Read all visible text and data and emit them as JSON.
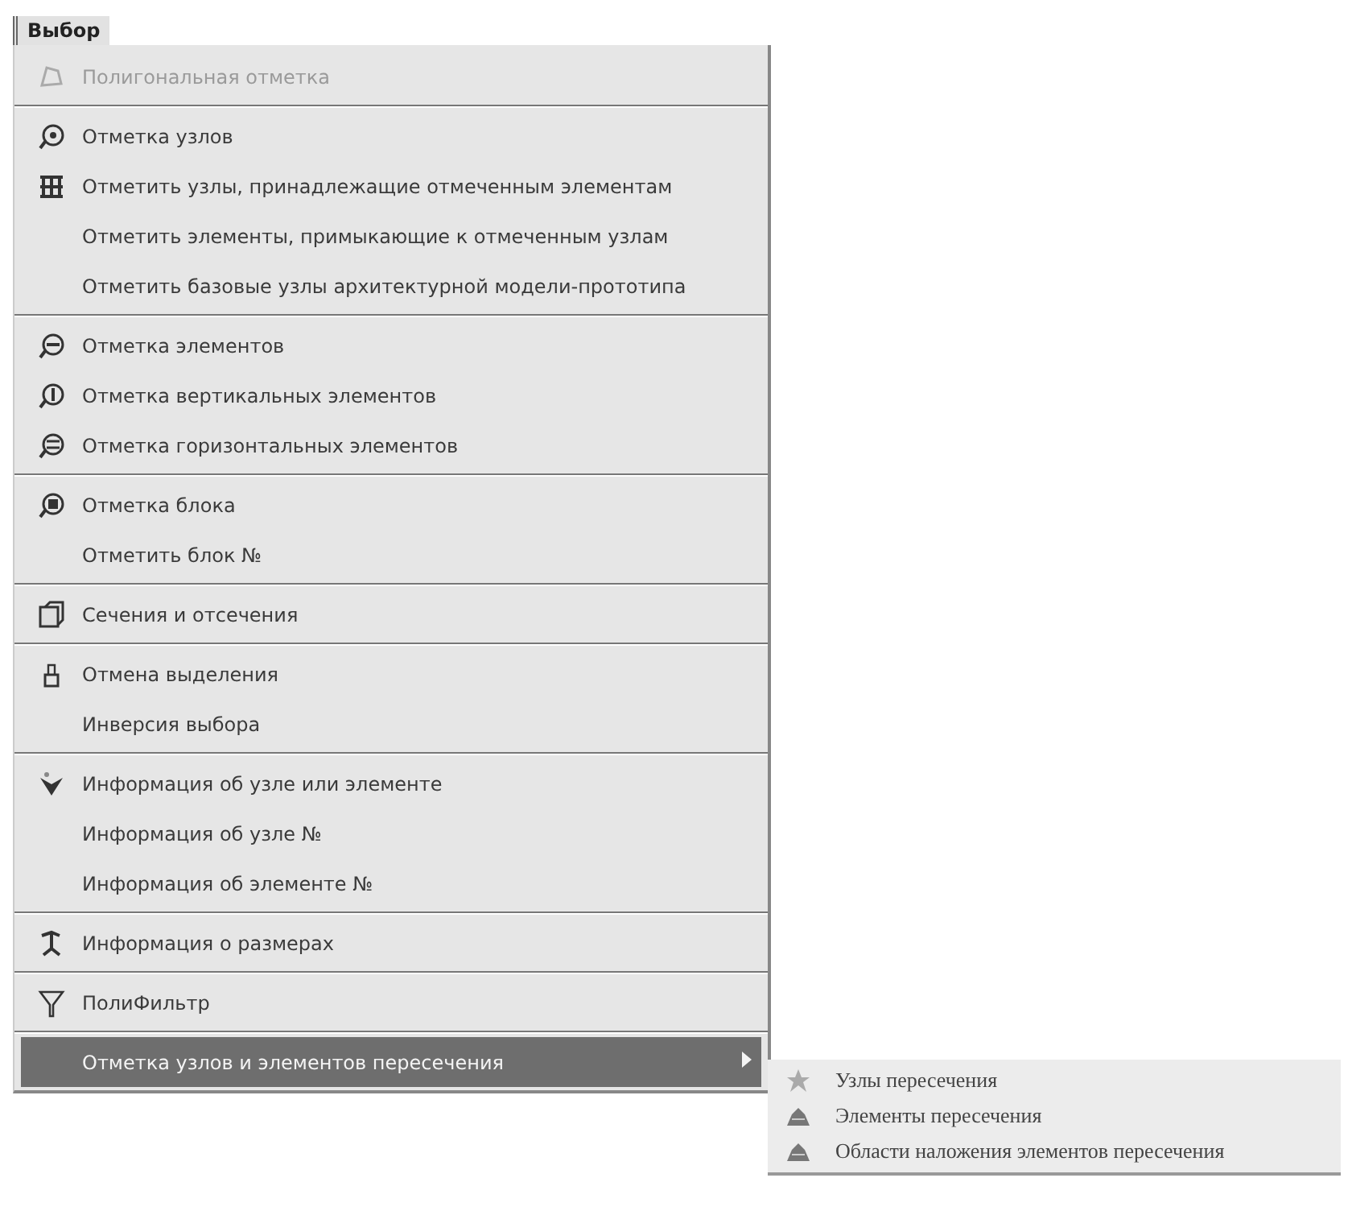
{
  "menu_title": "Выбор",
  "groups": [
    [
      {
        "label": "Полигональная отметка",
        "disabled": true,
        "selected": false
      }
    ],
    [
      {
        "label": "Отметка узлов",
        "disabled": false,
        "selected": false
      },
      {
        "label": "Отметить узлы, принадлежащие отмеченным элементам",
        "disabled": false,
        "selected": false
      },
      {
        "label": "Отметить элементы, примыкающие к отмеченным узлам",
        "disabled": false,
        "selected": false
      },
      {
        "label": "Отметить базовые узлы архитектурной модели-прототипа",
        "disabled": false,
        "selected": false
      }
    ],
    [
      {
        "label": "Отметка элементов",
        "disabled": false,
        "selected": false
      },
      {
        "label": "Отметка вертикальных элементов",
        "disabled": false,
        "selected": false
      },
      {
        "label": "Отметка горизонтальных элементов",
        "disabled": false,
        "selected": false
      }
    ],
    [
      {
        "label": "Отметка блока",
        "disabled": false,
        "selected": false
      },
      {
        "label": "Отметить блок №",
        "disabled": false,
        "selected": false
      }
    ],
    [
      {
        "label": "Сечения и отсечения",
        "disabled": false,
        "selected": false
      }
    ],
    [
      {
        "label": "Отмена выделения",
        "disabled": false,
        "selected": false
      },
      {
        "label": "Инверсия выбора",
        "disabled": false,
        "selected": false
      }
    ],
    [
      {
        "label": "Информация об узле или элементе",
        "disabled": false,
        "selected": false
      },
      {
        "label": "Информация об узле №",
        "disabled": false,
        "selected": false
      },
      {
        "label": "Информация об элементе №",
        "disabled": false,
        "selected": false
      }
    ],
    [
      {
        "label": "Информация о размерах",
        "disabled": false,
        "selected": false
      }
    ],
    [
      {
        "label": "ПолиФильтр",
        "disabled": false,
        "selected": false
      }
    ],
    [
      {
        "label": "Отметка узлов и элементов пересечения",
        "disabled": false,
        "selected": true,
        "submenu": [
          {
            "label": "Узлы пересечения"
          },
          {
            "label": "Элементы пересечения"
          },
          {
            "label": "Области наложения элементов пересечения"
          }
        ]
      }
    ]
  ]
}
